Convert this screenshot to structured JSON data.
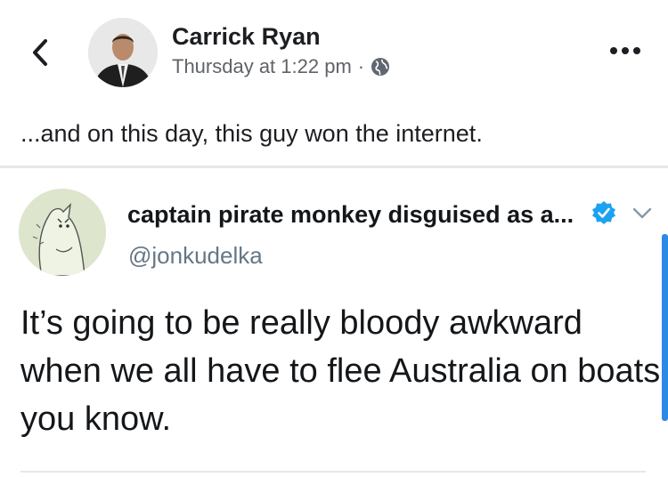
{
  "post": {
    "author": "Carrick Ryan",
    "timestamp": "Thursday at 1:22 pm",
    "separator": "·",
    "caption": "...and on this day, this guy won the internet.",
    "icons": {
      "back": "chevron-left-icon",
      "privacy": "globe-icon",
      "more": "more-options-icon"
    }
  },
  "tweet": {
    "display_name": "captain pirate monkey disguised as a...",
    "handle": "@jonkudelka",
    "text": "It’s going to be really bloody awkward when we all have to flee Australia on boats you know.",
    "icons": {
      "verified": "verified-badge-icon",
      "menu": "chevron-down-icon"
    },
    "colors": {
      "verified": "#1da1f2"
    }
  }
}
